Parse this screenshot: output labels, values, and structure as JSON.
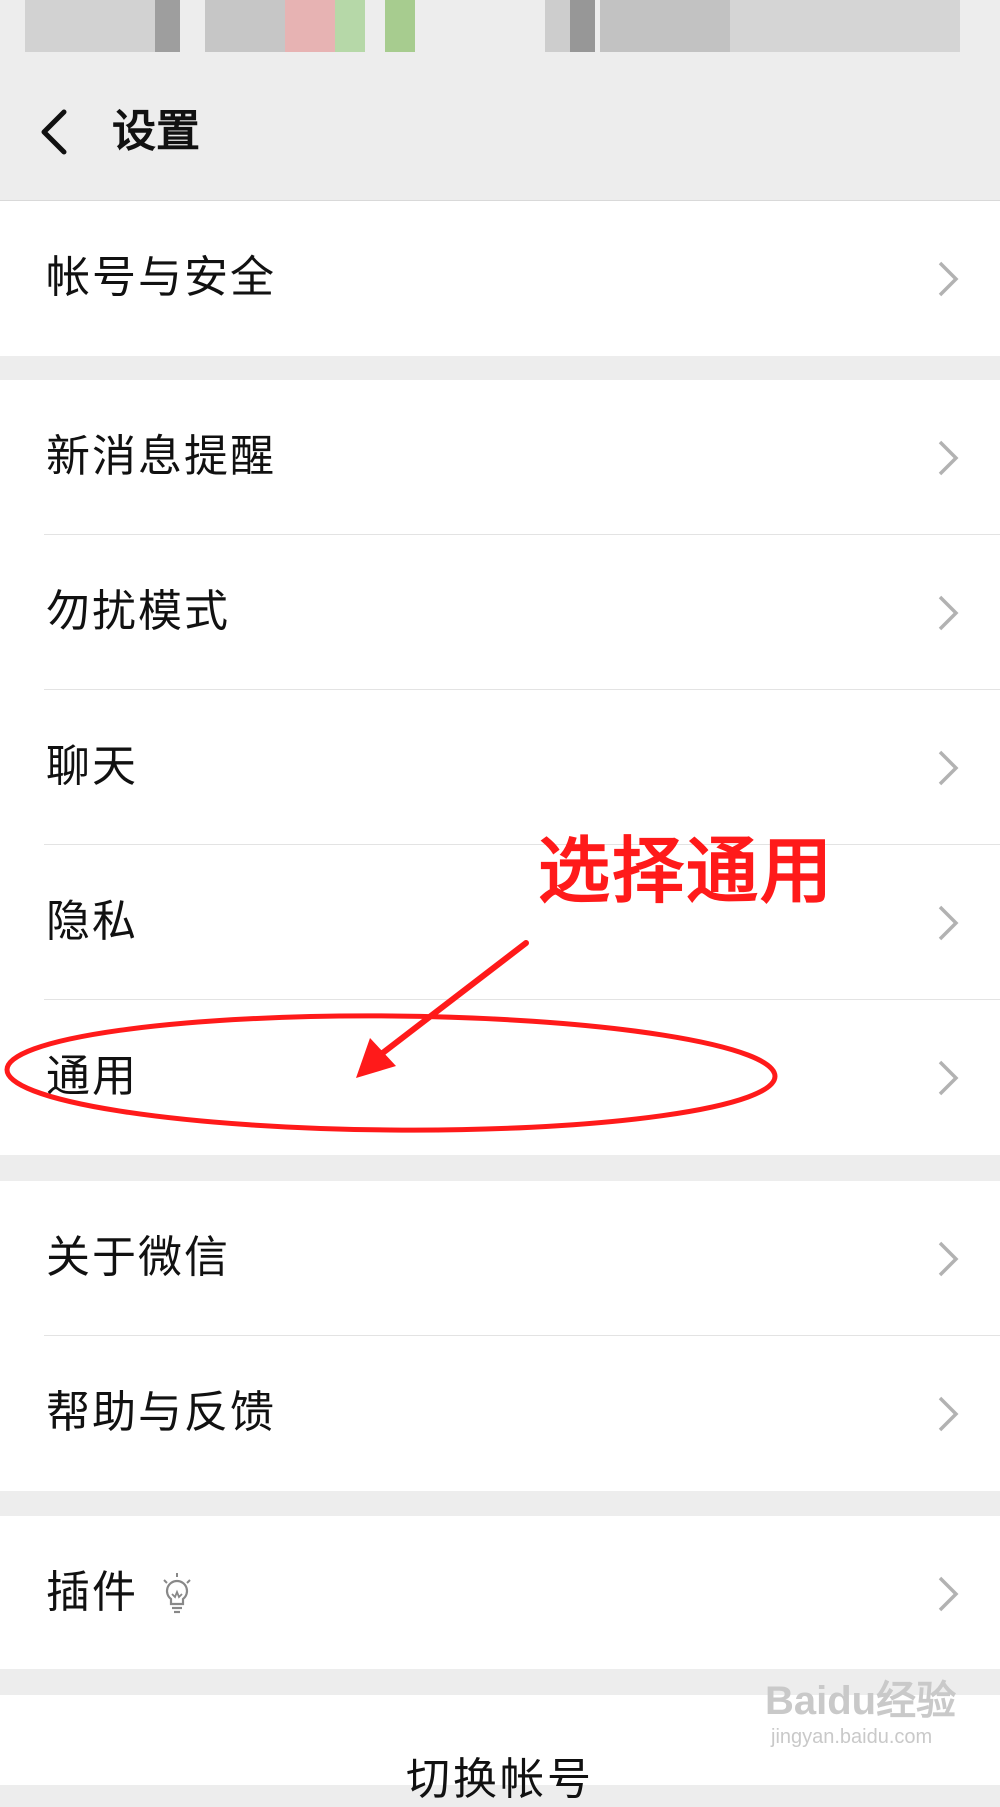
{
  "header": {
    "title": "设置"
  },
  "groups": [
    {
      "items": [
        {
          "label": "帐号与安全"
        }
      ]
    },
    {
      "items": [
        {
          "label": "新消息提醒"
        },
        {
          "label": "勿扰模式"
        },
        {
          "label": "聊天"
        },
        {
          "label": "隐私"
        },
        {
          "label": "通用"
        }
      ]
    },
    {
      "items": [
        {
          "label": "关于微信"
        },
        {
          "label": "帮助与反馈"
        }
      ]
    },
    {
      "items": [
        {
          "label": "插件",
          "icon": "lightbulb-icon"
        }
      ]
    }
  ],
  "bottom": {
    "label": "切换帐号"
  },
  "annotation": {
    "text": "选择通用",
    "color": "#ff1a1a"
  },
  "watermark": {
    "brand": "Baidu经验",
    "site": "jingyan.baidu.com"
  },
  "colors": {
    "background": "#ededed",
    "row": "#ffffff",
    "text": "#111111",
    "chevron": "#b2b2b2"
  }
}
